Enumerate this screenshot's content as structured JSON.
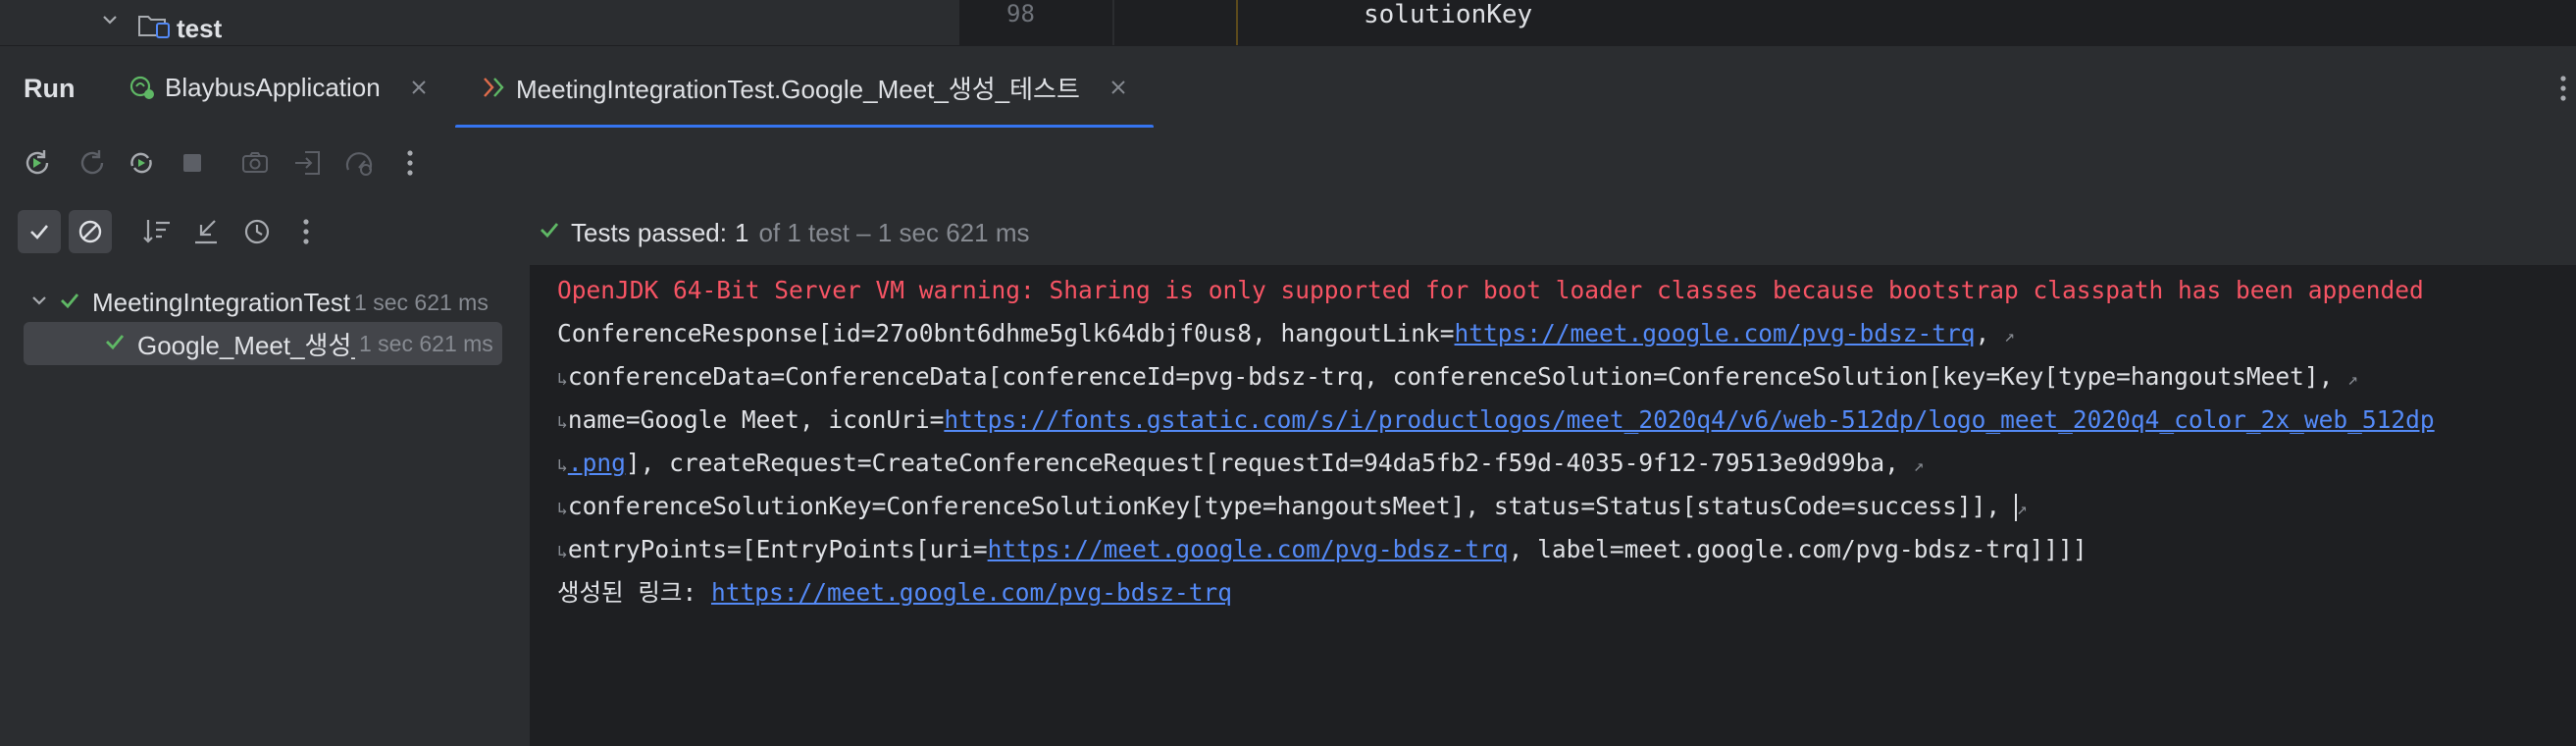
{
  "project_tree": {
    "folder_label": "test"
  },
  "editor": {
    "line_number": "98",
    "code": "solutionKey"
  },
  "run_panel": {
    "title": "Run",
    "tabs": [
      {
        "label": "BlaybusApplication"
      },
      {
        "label": "MeetingIntegrationTest.Google_Meet_생성_테스트"
      }
    ]
  },
  "test_status": {
    "passed_label": "Tests passed:",
    "passed_count": "1",
    "summary": "of 1 test – 1 sec 621 ms"
  },
  "test_tree": [
    {
      "name": "MeetingIntegrationTest",
      "time": "1 sec 621 ms",
      "status": "passed"
    },
    {
      "name": "Google_Meet_생성_테스트",
      "time": "1 sec 621 ms",
      "status": "passed"
    }
  ],
  "console": {
    "warning": "OpenJDK 64-Bit Server VM warning: Sharing is only supported for boot loader classes because bootstrap classpath has been appended",
    "line2_a": "ConferenceResponse[id=27o0bnt6dhme5glk64dbjf0us8, hangoutLink=",
    "line2_link": "https://meet.google.com/pvg-bdsz-trq",
    "line2_b": ",",
    "line3": "conferenceData=ConferenceData[conferenceId=pvg-bdsz-trq, conferenceSolution=ConferenceSolution[key=Key[type=hangoutsMeet],",
    "line4_a": "name=Google Meet, iconUri=",
    "line4_link": "https://fonts.gstatic.com/s/i/productlogos/meet_2020q4/v6/web-512dp/logo_meet_2020q4_color_2x_web_512dp",
    "line5_link": ".png",
    "line5_b": "], createRequest=CreateConferenceRequest[requestId=94da5fb2-f59d-4035-9f12-79513e9d99ba,",
    "line6": "conferenceSolutionKey=ConferenceSolutionKey[type=hangoutsMeet], status=Status[statusCode=success]],",
    "line7_a": "entryPoints=[EntryPoints[uri=",
    "line7_link": "https://meet.google.com/pvg-bdsz-trq",
    "line7_b": ", label=meet.google.com/pvg-bdsz-trq]]]]",
    "line8_a": "생성된 링크: ",
    "line8_link": "https://meet.google.com/pvg-bdsz-trq"
  },
  "colors": {
    "accent": "#3574f0",
    "success": "#5fb865",
    "error_text": "#f75464",
    "link": "#548af7"
  }
}
